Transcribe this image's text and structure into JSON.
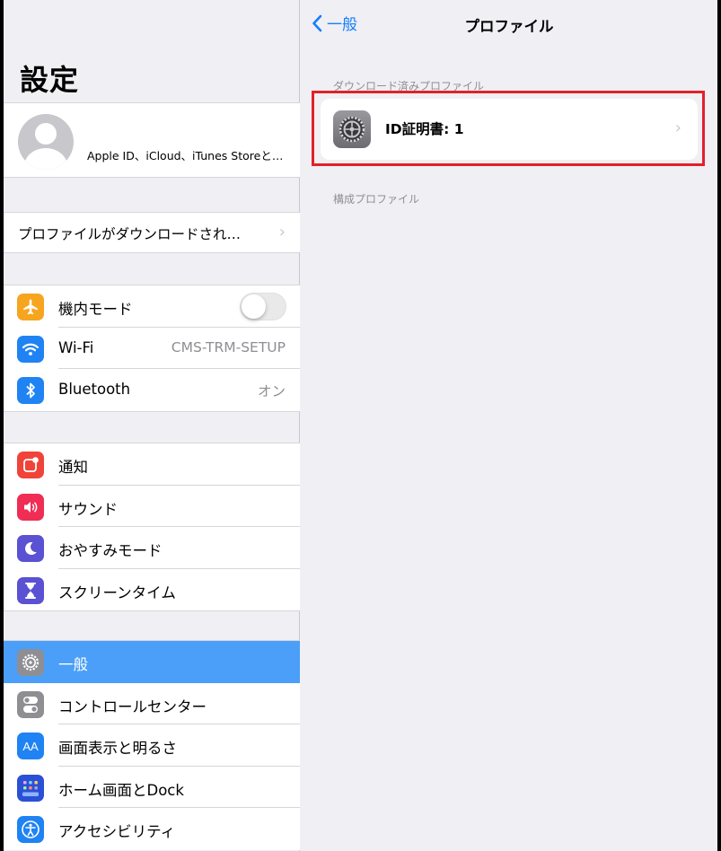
{
  "master": {
    "title": "設定",
    "profile": {
      "text": "Apple ID、iCloud、iTunes Storeと…"
    },
    "downloaded_notice": "プロファイルがダウンロードされ…",
    "network": [
      {
        "label": "機内モード",
        "icon": "airplane-icon",
        "color": "#f7a51f",
        "toggle": false
      },
      {
        "label": "Wi-Fi",
        "icon": "wifi-icon",
        "color": "#1f83f3",
        "value": "CMS-TRM-SETUP"
      },
      {
        "label": "Bluetooth",
        "icon": "bluetooth-icon",
        "color": "#1f83f3",
        "value": "オン"
      }
    ],
    "notifications": [
      {
        "label": "通知",
        "icon": "notifications-icon",
        "color": "#f0443a"
      },
      {
        "label": "サウンド",
        "icon": "sound-icon",
        "color": "#f02d55"
      },
      {
        "label": "おやすみモード",
        "icon": "moon-icon",
        "color": "#5a51d3"
      },
      {
        "label": "スクリーンタイム",
        "icon": "hourglass-icon",
        "color": "#5a51d3"
      }
    ],
    "general": [
      {
        "label": "一般",
        "icon": "gear-icon",
        "color": "#8e8e93",
        "selected": true
      },
      {
        "label": "コントロールセンター",
        "icon": "switches-icon",
        "color": "#8e8e93"
      },
      {
        "label": "画面表示と明るさ",
        "icon": "text-size-icon",
        "color": "#1f83f3",
        "icon_text": "AA"
      },
      {
        "label": "ホーム画面とDock",
        "icon": "home-grid-icon",
        "color": "#2a50d6"
      },
      {
        "label": "アクセシビリティ",
        "icon": "accessibility-icon",
        "color": "#1f83f3"
      }
    ]
  },
  "detail": {
    "back_label": "一般",
    "title": "プロファイル",
    "downloaded_header": "ダウンロード済みプロファイル",
    "profile_item": "ID証明書: 1",
    "config_header": "構成プロファイル"
  }
}
